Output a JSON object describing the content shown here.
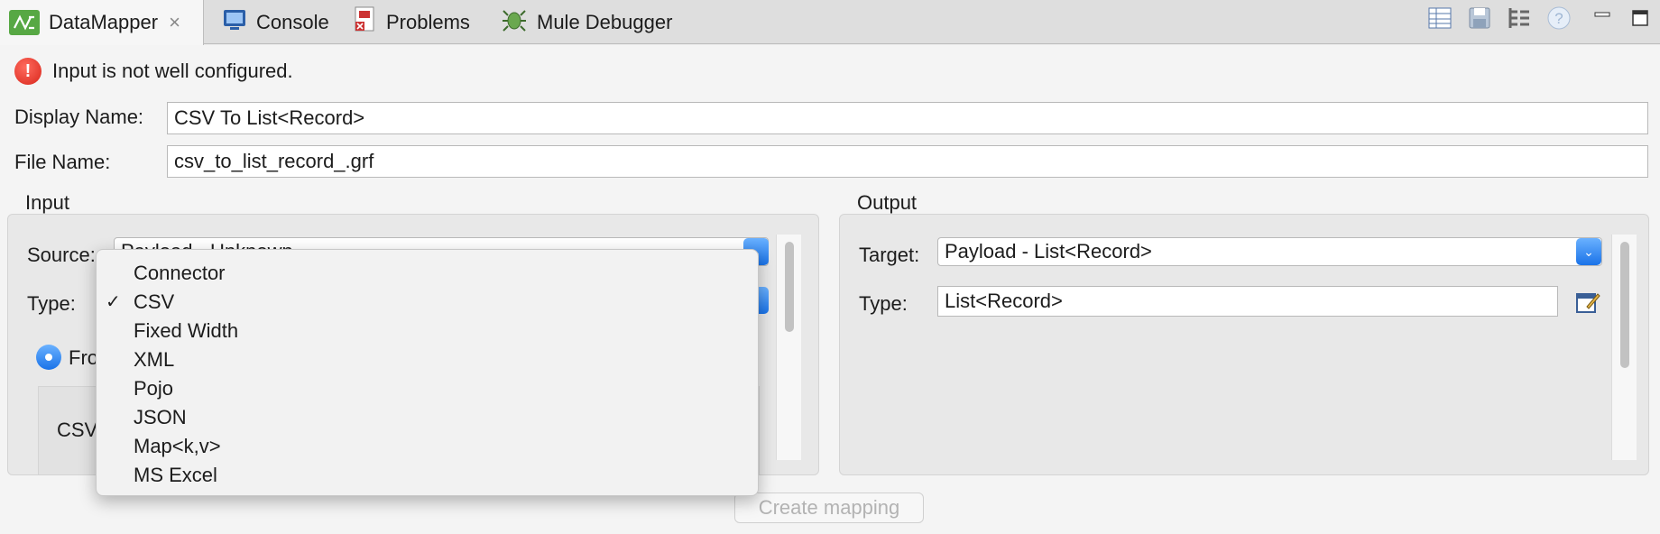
{
  "tabs": [
    {
      "label": "DataMapper",
      "icon": "datamapper-icon",
      "active": true,
      "close": "×"
    },
    {
      "label": "Console",
      "icon": "console-icon"
    },
    {
      "label": "Problems",
      "icon": "problems-icon"
    },
    {
      "label": "Mule Debugger",
      "icon": "mule-debugger-icon"
    }
  ],
  "toolbar_icons": [
    "table-view-icon",
    "save-icon",
    "tree-view-icon",
    "help-icon",
    "minimize-icon",
    "maximize-icon"
  ],
  "message": {
    "icon": "!",
    "text": "Input is not well configured."
  },
  "form": {
    "display_name_label": "Display Name:",
    "display_name_value": "CSV To List<Record>",
    "file_name_label": "File Name:",
    "file_name_value": "csv_to_list_record_.grf"
  },
  "input": {
    "title": "Input",
    "source_label": "Source:",
    "source_value_partial": "Payload - Unknown",
    "type_label": "Type:",
    "radio_partial": "Fro",
    "csv_partial": "CSV"
  },
  "output": {
    "title": "Output",
    "target_label": "Target:",
    "target_value": "Payload - List<Record>",
    "type_label": "Type:",
    "type_value": "List<Record>"
  },
  "dropdown": {
    "items": [
      "Connector",
      "CSV",
      "Fixed Width",
      "XML",
      "Pojo",
      "JSON",
      "Map<k,v>",
      "MS Excel"
    ],
    "selected": "CSV",
    "check": "✓"
  },
  "create_mapping_label": "Create mapping",
  "colors": {
    "accent": "#1a73e8",
    "error": "#d8261b"
  }
}
